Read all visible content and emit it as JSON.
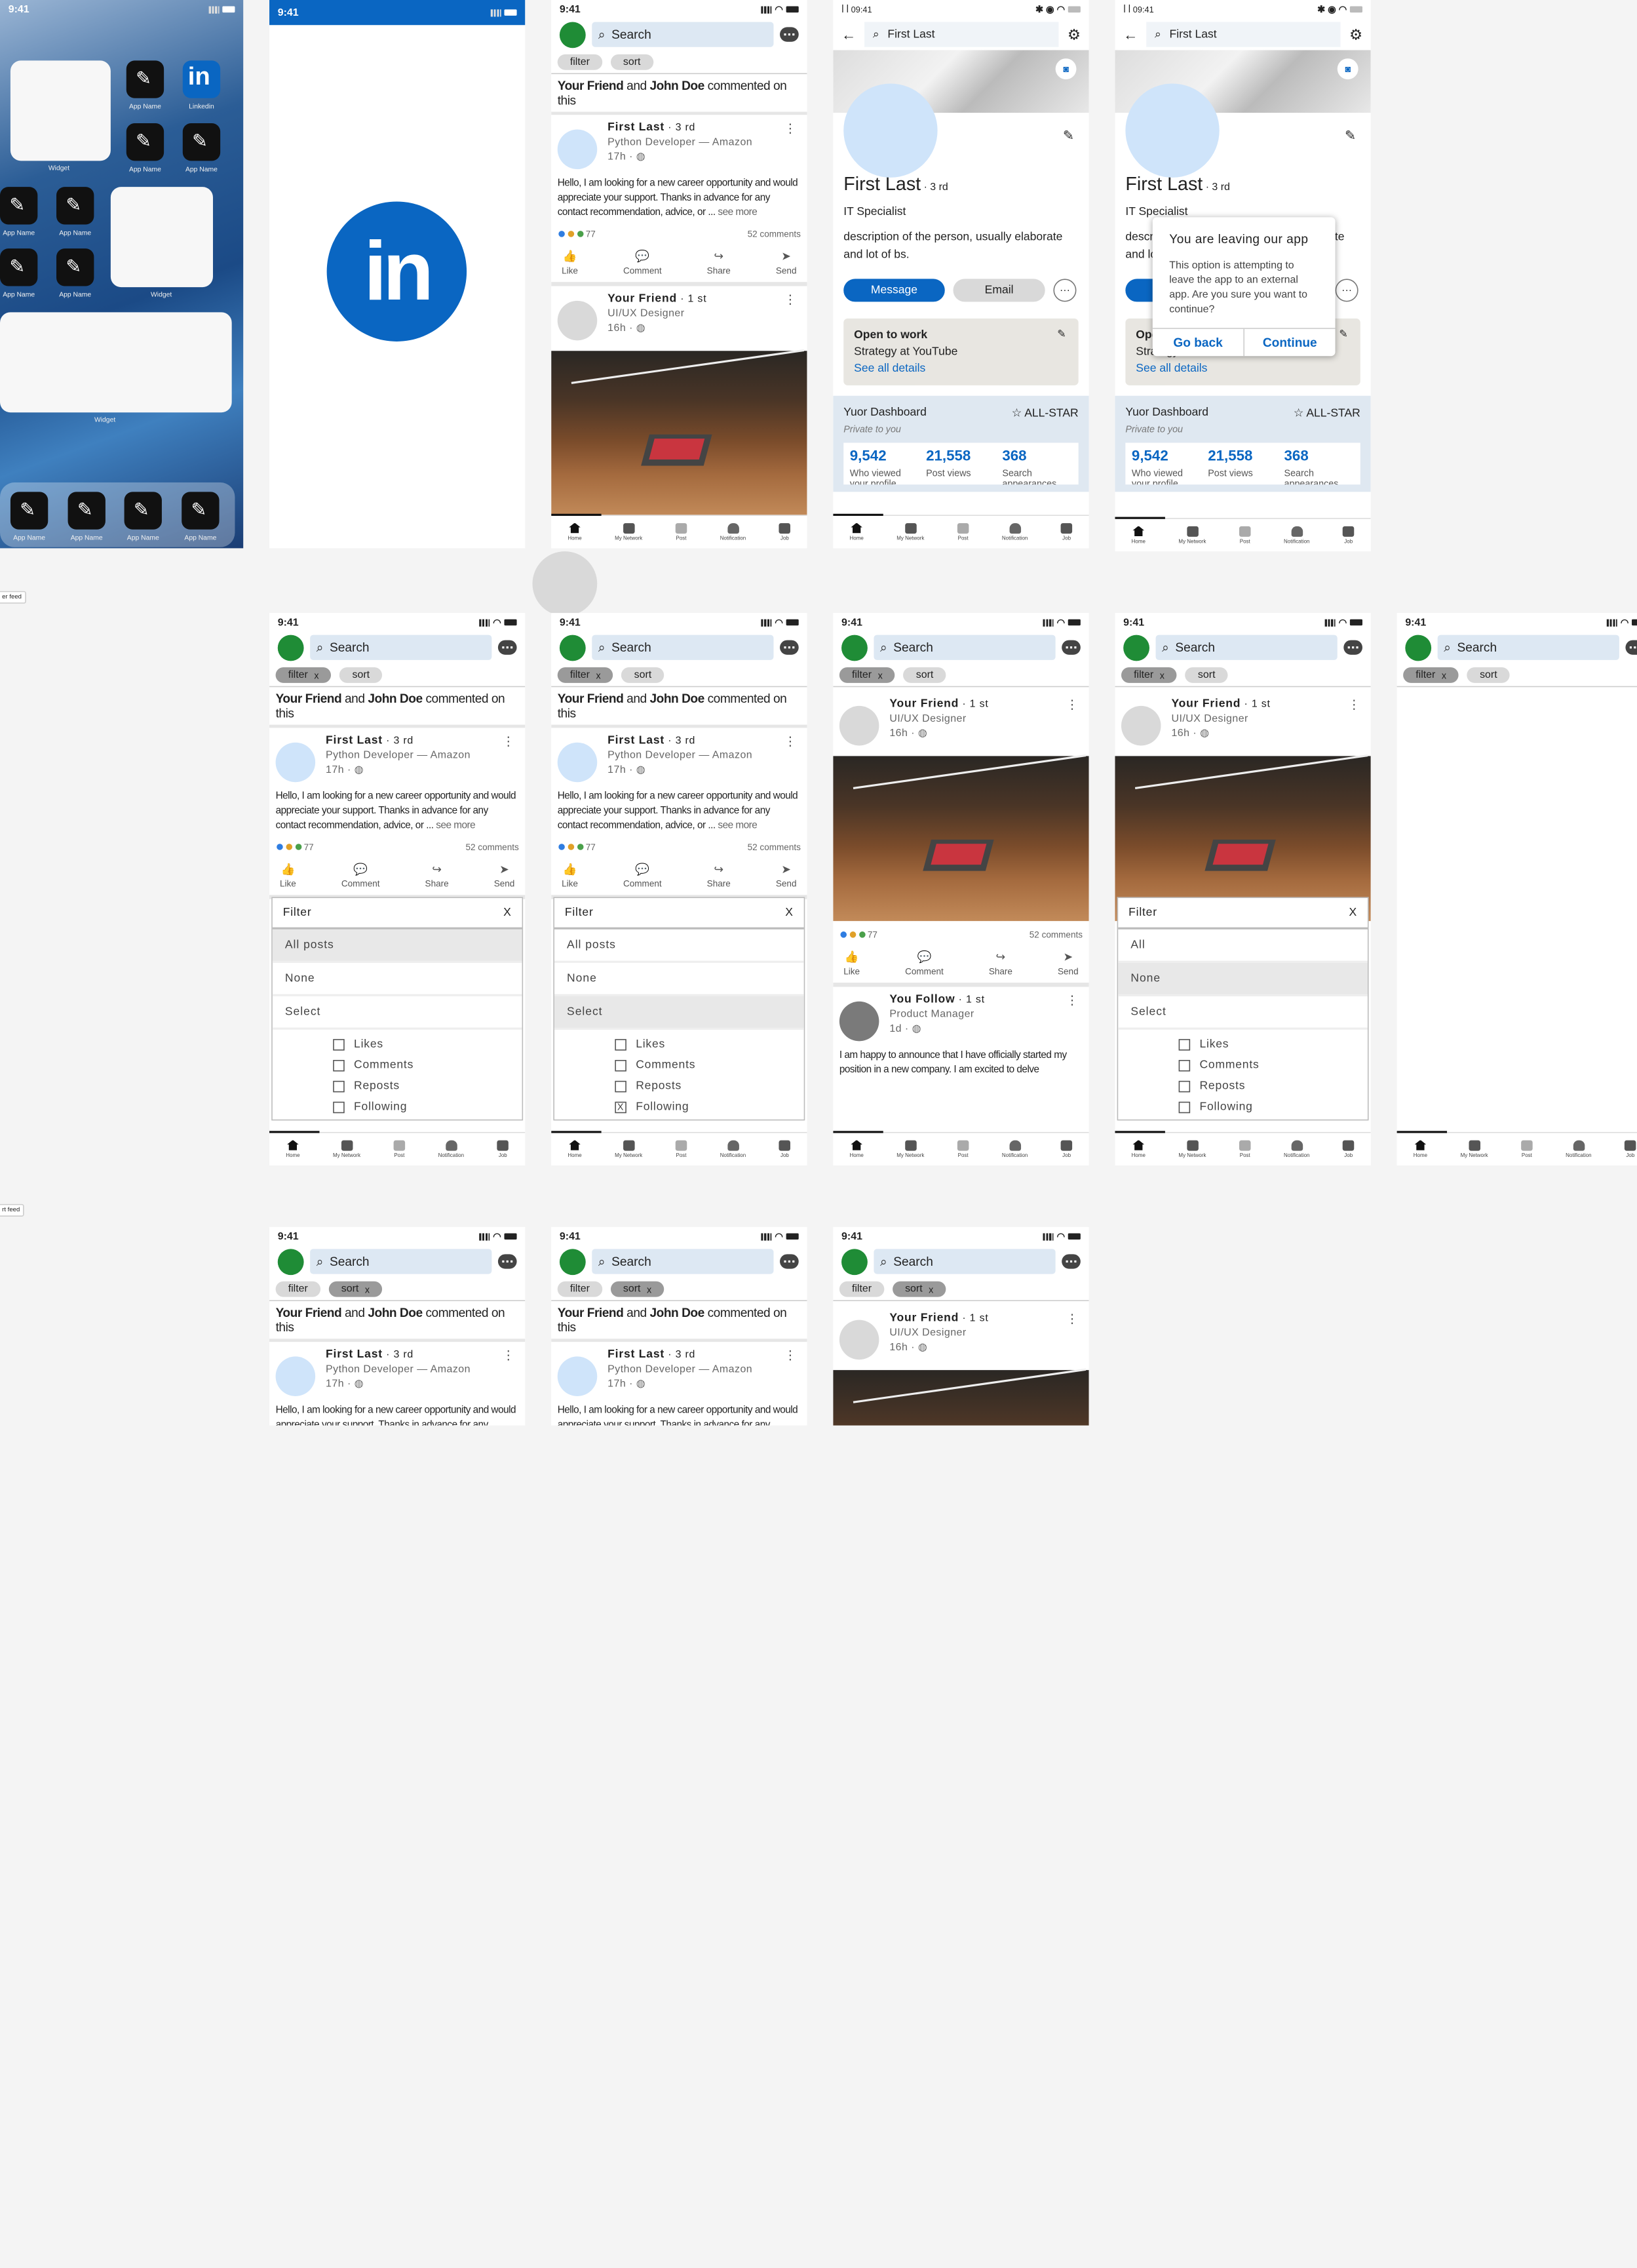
{
  "status": {
    "time": "9:41",
    "time2": "09:41",
    "signal_label": "ꟾ ꟾ"
  },
  "home": {
    "widget": "Widget",
    "app": "App Name",
    "linkedin": "Linkedin"
  },
  "feed": {
    "search": "Search",
    "filter": "filter",
    "sort": "sort",
    "x": "x",
    "context_bold1": "Your Friend",
    "context_and": " and ",
    "context_bold2": "John Doe",
    "context_rest": " commented on this",
    "post1": {
      "name": "First Last",
      "degree": " · 3 rd",
      "sub": "Python Developer — Amazon",
      "time": "17h · ",
      "text": "Hello, I am looking for a new career opportunity and would appreciate your support. Thanks in advance for any contact recommendation, advice, or ... ",
      "more": "see more",
      "reactions": "77",
      "comments": "52 comments"
    },
    "post2": {
      "name": "Your Friend",
      "degree": " · 1 st",
      "sub": "UI/UX Designer",
      "time": "16h · "
    },
    "post3": {
      "name": "You Follow",
      "degree": " · 1 st",
      "sub": "Product Manager",
      "time": "1d · ",
      "text": "I am happy to announce that I have officially started my position in a new company. I am excited to delve"
    },
    "actions": {
      "like": "Like",
      "comment": "Comment",
      "share": "Share",
      "send": "Send"
    },
    "tabs": {
      "home": "Home",
      "network": "My Network",
      "post": "Post",
      "notification": "Notification",
      "job": "Job"
    }
  },
  "filter": {
    "title": "Filter",
    "close": "X",
    "all_posts": "All posts",
    "all": "All",
    "none": "None",
    "select": "Select",
    "likes": "Likes",
    "comments": "Comments",
    "reposts": "Reposts",
    "following": "Following",
    "check": "X"
  },
  "profile": {
    "search": "First Last",
    "name": "First Last",
    "degree": " · 3 rd",
    "title": "IT Specialist",
    "title_short": "IT Sp",
    "desc": "description of the person, usually elaborate and lot of bs.",
    "message": "Message",
    "email": "Email",
    "more": "···",
    "otw_title": "Open to work",
    "otw_role": "Strategy at YouTube",
    "otw_link": "See all details",
    "dash_title": "Yuor Dashboard",
    "allstar": "ALL-STAR",
    "private": "Private to you",
    "stat1": "9,542",
    "stat1_l": "Who viewed your profile",
    "stat2": "21,558",
    "stat2_l": "Post views",
    "stat3": "368",
    "stat3_l": "Search appearances"
  },
  "modal": {
    "title": "You are leaving our app",
    "body": "This option is attempting to leave the app to an external app. Are you sure you want to continue?",
    "back": "Go back",
    "cont": "Continue"
  },
  "labels": {
    "l1": "er feed",
    "l2": "rt feed"
  },
  "colors": {
    "brand": "#0a66c2",
    "avatar": "#1f8c36"
  }
}
